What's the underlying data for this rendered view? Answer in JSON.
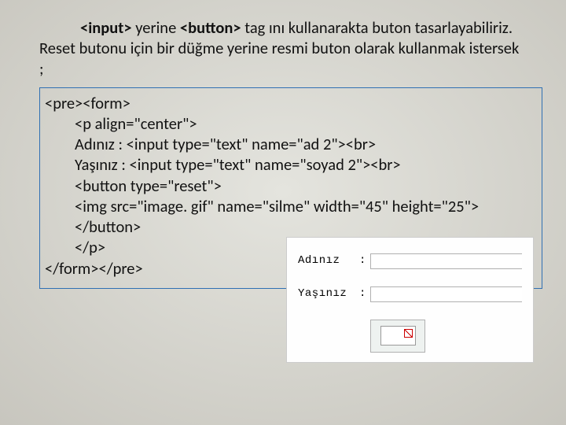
{
  "lead": {
    "seg1": "<input>",
    "seg2": " yerine ",
    "seg3": "<button>",
    "seg4": " tag ını kullanarakta buton tasarlayabiliriz. Reset butonu için bir düğme yerine resmi buton olarak kullanmak istersek ;"
  },
  "code": {
    "l1": "<pre><form>",
    "l2": "<p align=\"center\">",
    "l3": "Adınız  : <input type=\"text\" name=\"ad 2\"><br>",
    "l4": "Yaşınız : <input type=\"text\" name=\"soyad 2\"><br>",
    "l5": "<button type=\"reset\">",
    "l6": "<img src=\"image. gif\" name=\"silme\" width=\"45\" height=\"25\">",
    "l7": "</button>",
    "l8": "</p>",
    "l9": "</form></pre>"
  },
  "preview": {
    "label1": "Adınız",
    "label2": "Yaşınız",
    "colon": ":"
  }
}
